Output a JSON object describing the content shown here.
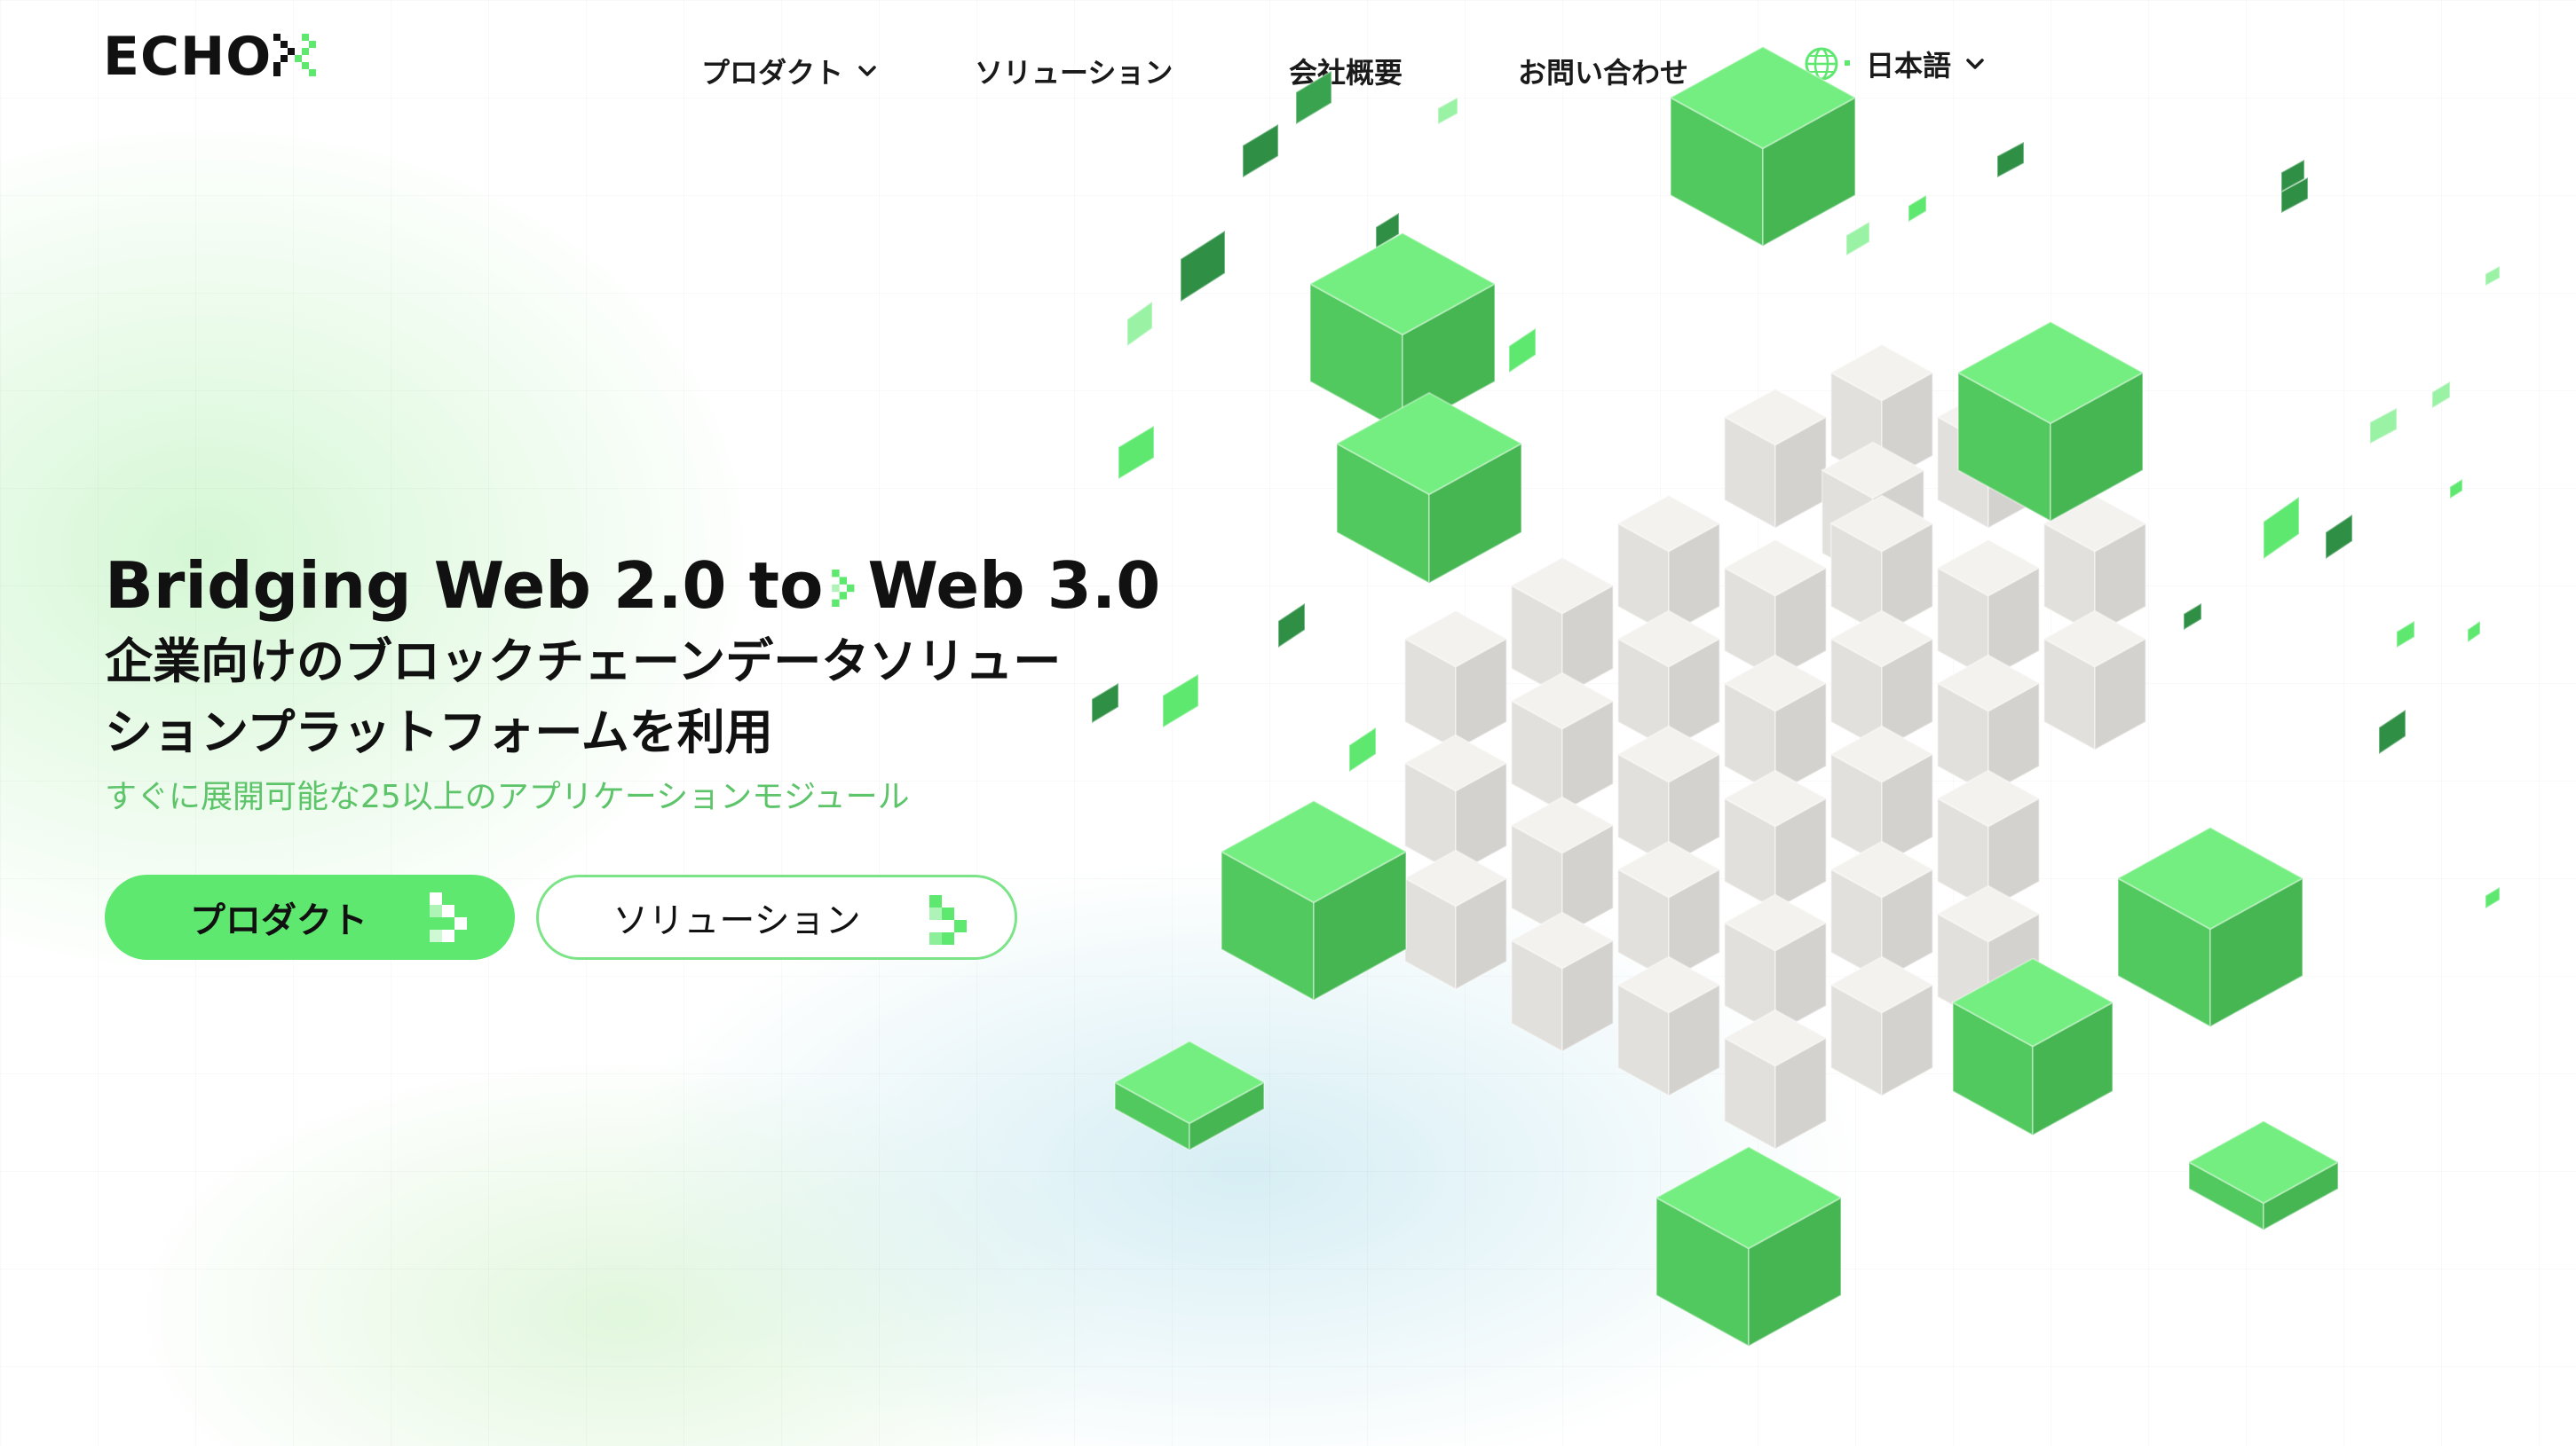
{
  "brand": {
    "logo_text": "ECHO"
  },
  "nav": {
    "products_label": "プロダクト",
    "solutions_label": "ソリューション",
    "company_label": "会社概要",
    "contact_label": "お問い合わせ",
    "language_label": "日本語"
  },
  "hero": {
    "headline_part1": "Bridging Web 2.0 to",
    "headline_part2": "Web 3.0",
    "subheadline": "企業向けのブロックチェーンデータソリューションプラットフォームを利用",
    "tagline": "すぐに展開可能な25以上のアプリケーションモジュール",
    "primary_button_label": "プロダクト",
    "secondary_button_label": "ソリューション"
  },
  "colors": {
    "accent_green": "#5ee86f",
    "tagline_green": "#5dc46a",
    "cube_white": "#ecebe8",
    "text_dark": "#111111"
  },
  "icons": {
    "products_chevron": "chevron-down-icon",
    "language_globe": "globe-icon",
    "language_chevron": "chevron-down-icon",
    "button_arrow": "pixel-arrow-icon",
    "logo_mark": "pixel-x-mark"
  }
}
